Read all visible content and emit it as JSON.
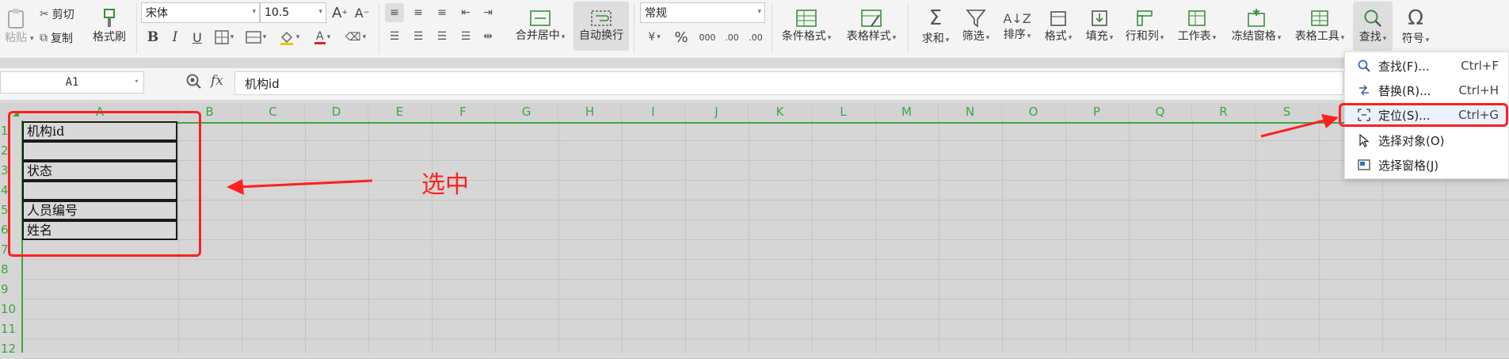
{
  "ribbon": {
    "paste": "粘贴",
    "cut": "剪切",
    "copy": "复制",
    "format_painter": "格式刷",
    "font_name": "宋体",
    "font_size": "10.5",
    "merge_center": "合并居中",
    "auto_wrap": "自动换行",
    "number_format": "常规",
    "conditional_format": "条件格式",
    "table_style": "表格样式",
    "sum": "求和",
    "filter": "筛选",
    "sort": "排序",
    "format": "格式",
    "fill": "填充",
    "row_col": "行和列",
    "worksheet": "工作表",
    "freeze": "冻结窗格",
    "table_tools": "表格工具",
    "find": "查找",
    "symbol": "符号",
    "glyph_bold": "B",
    "glyph_italic": "I",
    "glyph_underline": "U",
    "glyph_percent": "%",
    "glyph_thousand": "000",
    "glyph_inc_dec": ".00",
    "glyph_dec_dec": ".00",
    "glyph_fontA": "A",
    "glyph_currency": "¥"
  },
  "formula_bar": {
    "name_box": "A1",
    "fx": "fx",
    "content": "机构id"
  },
  "sheet": {
    "columns": [
      "A",
      "B",
      "C",
      "D",
      "E",
      "F",
      "G",
      "H",
      "I",
      "J",
      "K",
      "L",
      "M",
      "N",
      "O",
      "P",
      "Q",
      "R",
      "S"
    ],
    "rows": [
      "1",
      "2",
      "3",
      "4",
      "5",
      "6",
      "7",
      "8",
      "9",
      "10",
      "11",
      "12"
    ],
    "cells": [
      "机构id",
      "",
      "状态",
      "",
      "人员编号",
      "姓名"
    ]
  },
  "annotation": {
    "label": "选中",
    "color": "#ff2020"
  },
  "menu": {
    "items": [
      {
        "label": "查找(F)...",
        "shortcut": "Ctrl+F",
        "icon": "magnifier-icon"
      },
      {
        "label": "替换(R)...",
        "shortcut": "Ctrl+H",
        "icon": "replace-icon"
      },
      {
        "label": "定位(S)...",
        "shortcut": "Ctrl+G",
        "icon": "locate-icon"
      },
      {
        "label": "选择对象(O)",
        "shortcut": "",
        "icon": "pointer-icon"
      },
      {
        "label": "选择窗格(J)",
        "shortcut": "",
        "icon": "pane-icon"
      }
    ]
  },
  "colors": {
    "header_green": "#3fa544",
    "annotation_red": "#ff2020"
  }
}
